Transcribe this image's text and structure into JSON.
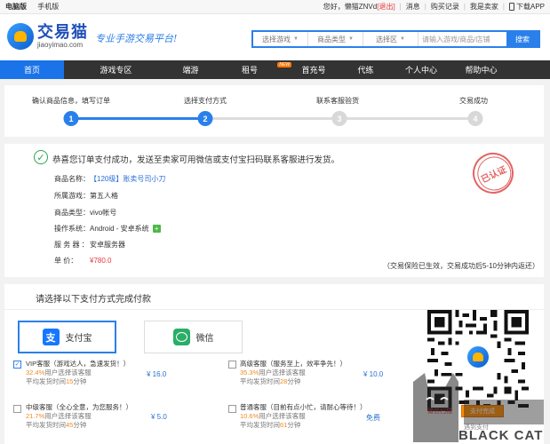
{
  "topbar": {
    "pc": "电脑版",
    "mobile": "手机版",
    "greeting": "您好，懒猫ZNVd",
    "logout": "[退出]",
    "sep": "|",
    "messages": "消息",
    "buy_records": "购买记录",
    "seller": "我是卖家",
    "download": "下载APP"
  },
  "header": {
    "logo_cn": "交易猫",
    "logo_en": "jiaoyimao.com",
    "slogan": "专业手游交易平台!",
    "search": {
      "game": "选择游戏",
      "type": "商品类型",
      "server": "选择区",
      "placeholder": "请输入游戏/商品/店铺",
      "button": "搜索"
    }
  },
  "nav": {
    "items": [
      "首页",
      "游戏专区",
      "端游",
      "租号",
      "首充号",
      "代练",
      "个人中心",
      "帮助中心"
    ],
    "new_badge": "NEW"
  },
  "steps": [
    {
      "num": "1",
      "label": "确认商品信息，填写订单"
    },
    {
      "num": "2",
      "label": "选择支付方式"
    },
    {
      "num": "3",
      "label": "联系客服验货"
    },
    {
      "num": "4",
      "label": "交易成功"
    }
  ],
  "success": {
    "message": "恭喜您订单支付成功，发送至卖家可用微信或支付宝扫码联系客服进行发货。",
    "rows": [
      {
        "key": "商品名称：",
        "value": "【120级】账卖号司小刀"
      },
      {
        "key": "所属游戏：",
        "value": "第五人格"
      },
      {
        "key": "商品类型：",
        "value": "vivo帐号"
      },
      {
        "key": "操作系统：",
        "value": "Android - 安卓系统"
      },
      {
        "key": "服 务 器 ：",
        "value": "安卓服务器"
      },
      {
        "key": "单    价：",
        "value": "¥780.0"
      }
    ],
    "stamp": "已认证",
    "guarantee": "（交易保险已生效，交易成功后5-10分钟内返还）"
  },
  "payment": {
    "title": "请选择以下支付方式完成付款",
    "alipay": "支付宝",
    "wechat": "微信",
    "alipay_glyph": "支",
    "services": [
      {
        "name": "VIP客服（游戏达人，急速发货！）",
        "pct": "32.4%",
        "pct_text": "用户选择该客服",
        "time_pre": "平均发货时间",
        "hours": "15",
        "time_post": "分钟",
        "price": "¥ 16.0",
        "checked": true
      },
      {
        "name": "高级客服（服务至上，效率争先！）",
        "pct": "35.3%",
        "pct_text": "用户选择该客服",
        "time_pre": "平均发货时间",
        "hours": "28",
        "time_post": "分钟",
        "price": "¥ 10.0",
        "checked": false
      },
      {
        "name": "中级客服（全心全意，为您服务！）",
        "pct": "21.7%",
        "pct_text": "用户选择该客服",
        "time_pre": "平均发货时间",
        "hours": "45",
        "time_post": "分钟",
        "price": "¥ 5.0",
        "checked": false
      },
      {
        "name": "普通客服（目前有点小忙，请耐心等待！）",
        "pct": "10.6%",
        "pct_text": "用户选择该客服",
        "time_pre": "平均发货时间",
        "hours": "61",
        "time_post": "分钟",
        "price": "免费",
        "checked": false
      }
    ],
    "check_glyph": "✓",
    "qr_tip_red": "微信扫描",
    "qr_tip_btn": "支付完成",
    "qr_tip_gray": "遇到支付"
  },
  "watermark": "BLACK CAT",
  "colors": {
    "accent": "#2a80ea",
    "nav_bg": "#333333",
    "success": "#2fa44f",
    "price": "#e4393c",
    "orange": "#f08a24"
  }
}
